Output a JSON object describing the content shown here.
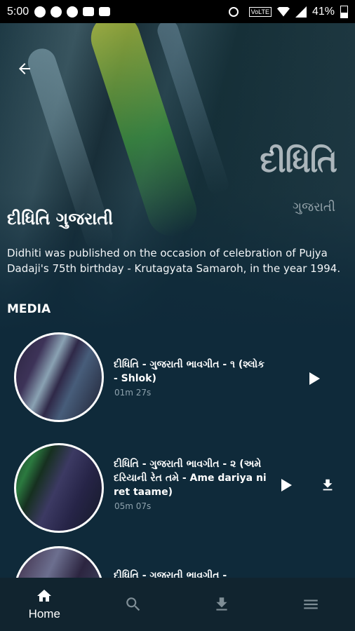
{
  "status_bar": {
    "time": "5:00",
    "battery": "41%",
    "network": "VoLTE"
  },
  "header": {
    "back_icon": "arrow-left-icon",
    "art_title": "દીધિતિ",
    "art_subtitle": "ગુજરાતી",
    "title": "દીધિતિ ગુજરાતી",
    "description": "Didhiti was published on the occasion of celebration of Pujya Dadaji's 75th birthday - Krutagyata  Samaroh, in the year 1994."
  },
  "media": {
    "section_label": "MEDIA",
    "items": [
      {
        "title": "દીધિતિ - ગુજરાતી ભાવગીત - ૧ (શ્લોક - Shlok)",
        "duration": "01m 27s"
      },
      {
        "title": "દીધિતિ - ગુજરાતી ભાવગીત - ૨ (અમે દરિયાની રેત તમે - Ame dariya ni ret taame)",
        "duration": "05m 07s"
      },
      {
        "title": "દીધિતિ - ગુજરાતી ભાવગીત -",
        "duration": ""
      }
    ]
  },
  "bottom_nav": {
    "items": [
      {
        "label": "Home",
        "icon": "home-icon"
      },
      {
        "label": "",
        "icon": "search-icon"
      },
      {
        "label": "",
        "icon": "download-icon"
      },
      {
        "label": "",
        "icon": "menu-icon"
      }
    ]
  },
  "colors": {
    "background": "#0f2a3a",
    "nav": "#11242f",
    "muted": "#8fa3ae"
  }
}
